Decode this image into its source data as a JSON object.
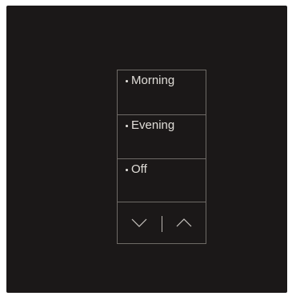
{
  "keypad": {
    "buttons": [
      {
        "label": "Morning"
      },
      {
        "label": "Evening"
      },
      {
        "label": "Off"
      }
    ],
    "rocker": {
      "down_icon": "chevron-down-icon",
      "up_icon": "chevron-up-icon"
    }
  },
  "colors": {
    "plate": "#1b1818",
    "outline": "#6e6a66",
    "text": "#e0ddd8",
    "led": "#e6e3de"
  }
}
